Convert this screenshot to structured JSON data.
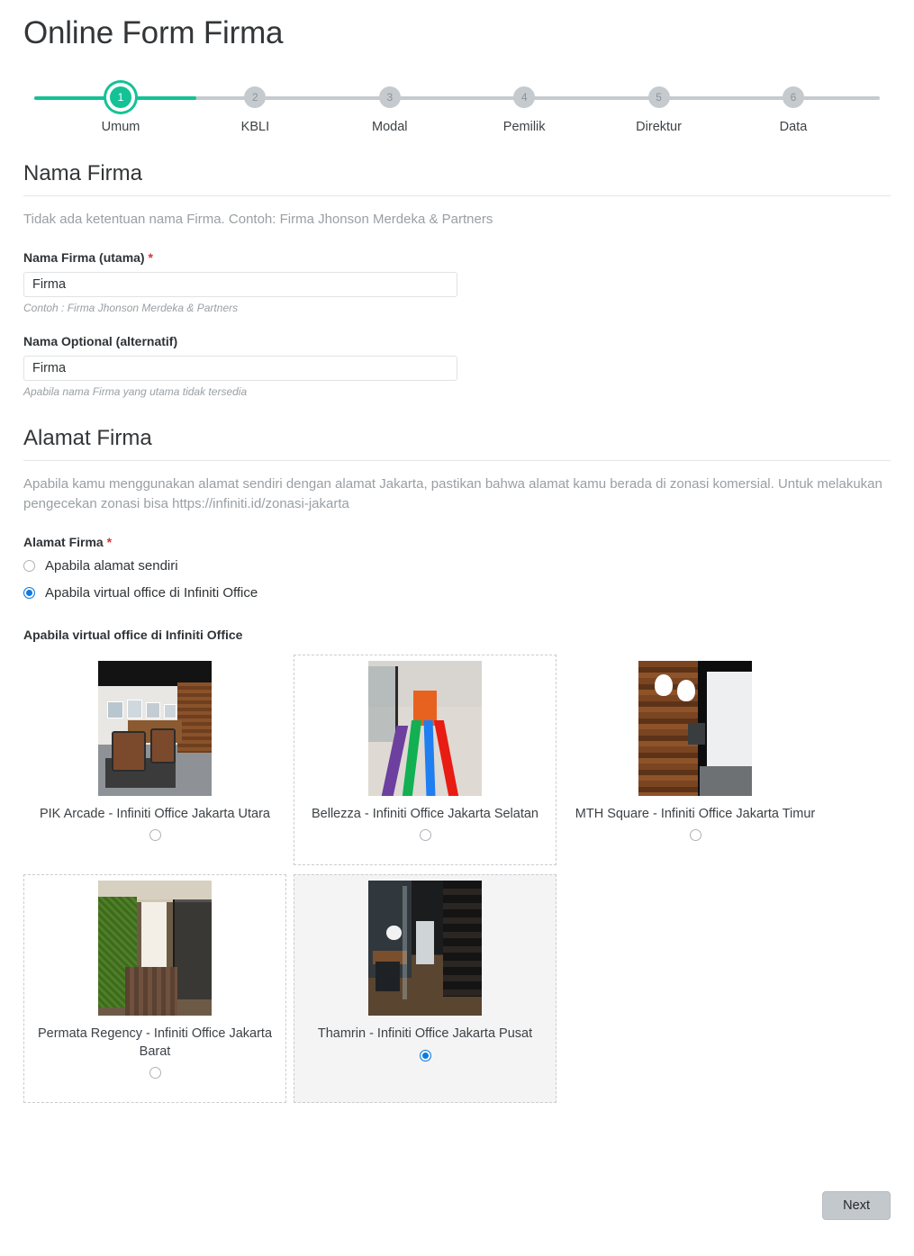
{
  "page": {
    "title": "Online Form Firma"
  },
  "stepper": {
    "active_index": 0,
    "accent_color": "#13c296",
    "inactive_color": "#c5cace",
    "steps": [
      {
        "number": "1",
        "label": "Umum"
      },
      {
        "number": "2",
        "label": "KBLI"
      },
      {
        "number": "3",
        "label": "Modal"
      },
      {
        "number": "4",
        "label": "Pemilik"
      },
      {
        "number": "5",
        "label": "Direktur"
      },
      {
        "number": "6",
        "label": "Data"
      }
    ]
  },
  "nama_firma": {
    "heading": "Nama Firma",
    "description": "Tidak ada ketentuan nama Firma. Contoh: Firma Jhonson Merdeka & Partners",
    "utama": {
      "label": "Nama Firma (utama)",
      "required_mark": "*",
      "value": "Firma",
      "placeholder": "Firma",
      "hint": "Contoh : Firma Jhonson Merdeka & Partners"
    },
    "optional": {
      "label": "Nama Optional (alternatif)",
      "value": "Firma",
      "placeholder": "Firma",
      "hint": "Apabila nama Firma yang utama tidak tersedia"
    }
  },
  "alamat_firma": {
    "heading": "Alamat Firma",
    "description": "Apabila kamu menggunakan alamat sendiri dengan alamat Jakarta, pastikan bahwa alamat kamu berada di zonasi komersial. Untuk melakukan pengecekan zonasi bisa https://infiniti.id/zonasi-jakarta",
    "field_label": "Alamat Firma",
    "required_mark": "*",
    "radio_accent": "#0d7ae0",
    "options": [
      {
        "label": "Apabila alamat sendiri",
        "checked": false
      },
      {
        "label": "Apabila virtual office di Infiniti Office",
        "checked": true
      }
    ]
  },
  "virtual_office": {
    "group_label": "Apabila virtual office di Infiniti Office",
    "cards": [
      {
        "title": "PIK Arcade - Infiniti Office Jakarta Utara",
        "image": "office-lounge-photo",
        "checked": false,
        "state": "plain"
      },
      {
        "title": "Bellezza - Infiniti Office Jakarta Selatan",
        "image": "corridor-color-stripes-photo",
        "checked": false,
        "state": "outlined"
      },
      {
        "title": "MTH Square - Infiniti Office Jakarta Timur",
        "image": "wood-wall-corridor-photo",
        "checked": false,
        "state": "plain"
      },
      {
        "title": "Permata Regency - Infiniti Office Jakarta Barat",
        "image": "green-moss-corridor-photo",
        "checked": false,
        "state": "outlined"
      },
      {
        "title": "Thamrin - Infiniti Office Jakarta Pusat",
        "image": "dark-cafe-corridor-photo",
        "checked": true,
        "state": "selected"
      }
    ]
  },
  "footer": {
    "next_label": "Next"
  }
}
